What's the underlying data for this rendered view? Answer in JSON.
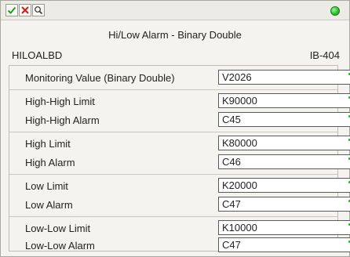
{
  "toolbar": {
    "buttons": [
      "accept-icon",
      "cancel-icon",
      "help-icon"
    ],
    "status_color": "#2fc62f"
  },
  "header": {
    "title": "Hi/Low Alarm - Binary Double",
    "instruction_code": "HILOALBD",
    "instruction_id": "IB-404"
  },
  "params": [
    {
      "label": "Monitoring Value (Binary Double)",
      "value": "V2026"
    },
    {
      "label": "High-High Limit",
      "value": "K90000"
    },
    {
      "label": "High-High Alarm",
      "value": "C45"
    },
    {
      "label": "High Limit",
      "value": "K80000"
    },
    {
      "label": "High Alarm",
      "value": "C46"
    },
    {
      "label": "Low Limit",
      "value": "K20000"
    },
    {
      "label": "Low Alarm",
      "value": "C47"
    },
    {
      "label": "Low-Low Limit",
      "value": "K10000"
    },
    {
      "label": "Low-Low Alarm",
      "value": "C47"
    }
  ]
}
